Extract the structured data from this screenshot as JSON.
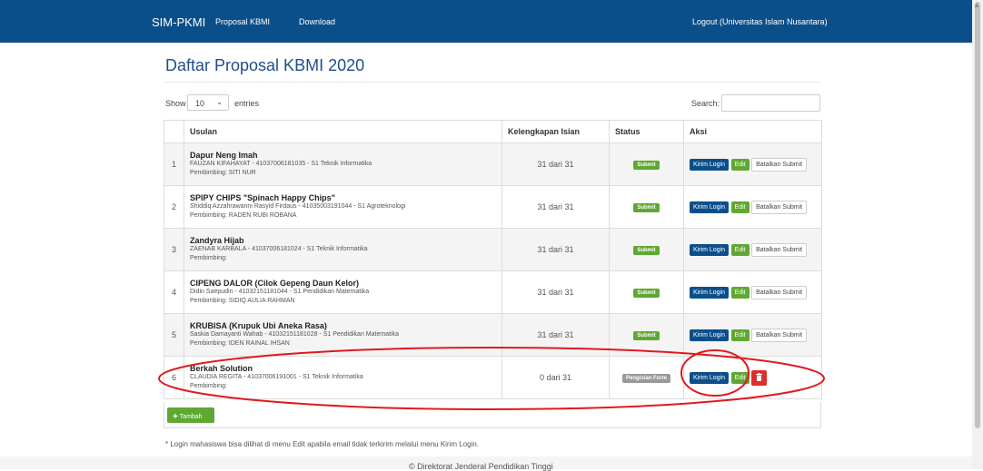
{
  "navbar": {
    "brand": "SIM-PKMI",
    "links": [
      "Proposal KBMI",
      "Download"
    ],
    "logout": "Logout (Universitas Islam Nusantara)"
  },
  "page": {
    "title": "Daftar Proposal KBMI 2020"
  },
  "controls": {
    "show_label": "Show",
    "entries_value": "10",
    "entries_label": "entries",
    "search_label": "Search:",
    "search_value": ""
  },
  "table": {
    "headers": [
      "",
      "Usulan",
      "Kelengkapan Isian",
      "Status",
      "Aksi"
    ],
    "rows": [
      {
        "no": "1",
        "title": "Dapur Neng Imah",
        "detail": "FAUZAN KIFAHAYAT - 41037006181035 - S1 Teknik Informatika",
        "supervisor": "Pembimbing: SITI NUR",
        "completeness": "31 dari 31",
        "status": "Submit",
        "actions": [
          "Kirim Login",
          "Edit",
          "Batalkan Submit"
        ]
      },
      {
        "no": "2",
        "title": "SPIPY CHIPS \"Spinach Happy Chips\"",
        "detail": "Shiddiq Azzahrawanni Rasyid Firdaus - 41035003191044 - S1 Agroteknologi",
        "supervisor": "Pembimbing: RADEN RUBI ROBANA",
        "completeness": "31 dari 31",
        "status": "Submit",
        "actions": [
          "Kirim Login",
          "Edit",
          "Batalkan Submit"
        ]
      },
      {
        "no": "3",
        "title": "Zandyra Hijab",
        "detail": "ZAENAB KARBALA - 41037006181024 - S1 Teknik Informatika",
        "supervisor": "Pembimbing:",
        "completeness": "31 dari 31",
        "status": "Submit",
        "actions": [
          "Kirim Login",
          "Edit",
          "Batalkan Submit"
        ]
      },
      {
        "no": "4",
        "title": "CIPENG DALOR (Cilok Gepeng Daun Kelor)",
        "detail": "Didin Saepudin - 41032151181044 - S1 Pendidikan Matematika",
        "supervisor": "Pembimbing: SIDIQ AULIA RAHMAN",
        "completeness": "31 dari 31",
        "status": "Submit",
        "actions": [
          "Kirim Login",
          "Edit",
          "Batalkan Submit"
        ]
      },
      {
        "no": "5",
        "title": "KRUBISA (Krupuk Ubi Aneka Rasa)",
        "detail": "Saskia Damayanti Wahab - 41032151181028 - S1 Pendidikan Matematika",
        "supervisor": "Pembimbing: IDEN RAINAL IHSAN",
        "completeness": "31 dari 31",
        "status": "Submit",
        "actions": [
          "Kirim Login",
          "Edit",
          "Batalkan Submit"
        ]
      },
      {
        "no": "6",
        "title": "Berkah Solution",
        "detail": "CLAUDIA REGITA - 41037006191001 - S1 Teknik Informatika",
        "supervisor": "Pembimbing:",
        "completeness": "0 dari 31",
        "status": "Pengisian Form",
        "actions": [
          "Kirim Login",
          "Edit",
          "trash-icon"
        ]
      }
    ]
  },
  "add_button": "Tambah",
  "footnote": "* Login mahasiswa bisa dilihat di menu Edit apabila email tidak terkirim melalui menu Kirim Login.",
  "footer": "© Direktorat Jenderal Pendidikan Tinggi",
  "colors": {
    "navbar": "#0b4f8a",
    "title": "#1f4e8c",
    "submit_badge": "#5fa832",
    "form_badge": "#999999",
    "delete_button": "#d9312b",
    "annotation": "#e0191e"
  }
}
